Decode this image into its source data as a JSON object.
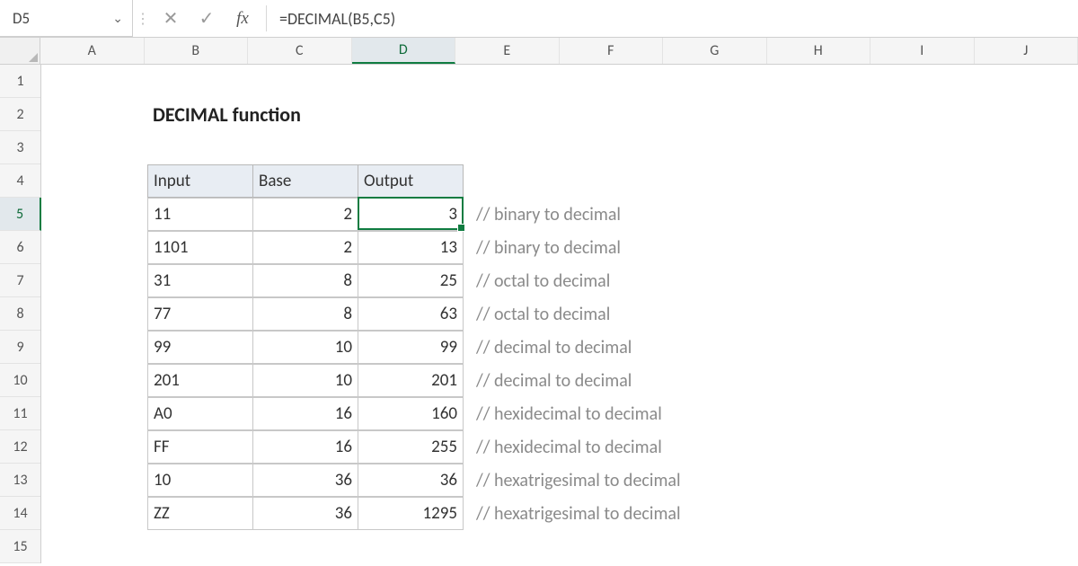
{
  "formula_bar": {
    "cell_ref": "D5",
    "formula": "=DECIMAL(B5,C5)"
  },
  "columns": [
    "A",
    "B",
    "C",
    "D",
    "E",
    "F",
    "G",
    "H",
    "I",
    "J"
  ],
  "active_col": "D",
  "rows": [
    "1",
    "2",
    "3",
    "4",
    "5",
    "6",
    "7",
    "8",
    "9",
    "10",
    "11",
    "12",
    "13",
    "14",
    "15"
  ],
  "active_row": "5",
  "title": "DECIMAL function",
  "headers": {
    "input": "Input",
    "base": "Base",
    "output": "Output"
  },
  "data": [
    {
      "input": "11",
      "base": "2",
      "output": "3",
      "comment": "// binary to decimal"
    },
    {
      "input": "1101",
      "base": "2",
      "output": "13",
      "comment": "// binary to decimal"
    },
    {
      "input": "31",
      "base": "8",
      "output": "25",
      "comment": "// octal to decimal"
    },
    {
      "input": "77",
      "base": "8",
      "output": "63",
      "comment": "// octal to decimal"
    },
    {
      "input": "99",
      "base": "10",
      "output": "99",
      "comment": "// decimal to decimal"
    },
    {
      "input": "201",
      "base": "10",
      "output": "201",
      "comment": "// decimal to decimal"
    },
    {
      "input": "A0",
      "base": "16",
      "output": "160",
      "comment": "// hexidecimal to decimal"
    },
    {
      "input": "FF",
      "base": "16",
      "output": "255",
      "comment": "// hexidecimal to decimal"
    },
    {
      "input": "10",
      "base": "36",
      "output": "36",
      "comment": "// hexatrigesimal to decimal"
    },
    {
      "input": "ZZ",
      "base": "36",
      "output": "1295",
      "comment": "// hexatrigesimal to decimal"
    }
  ],
  "active_cell": {
    "col_index": 3,
    "row_index": 4
  }
}
